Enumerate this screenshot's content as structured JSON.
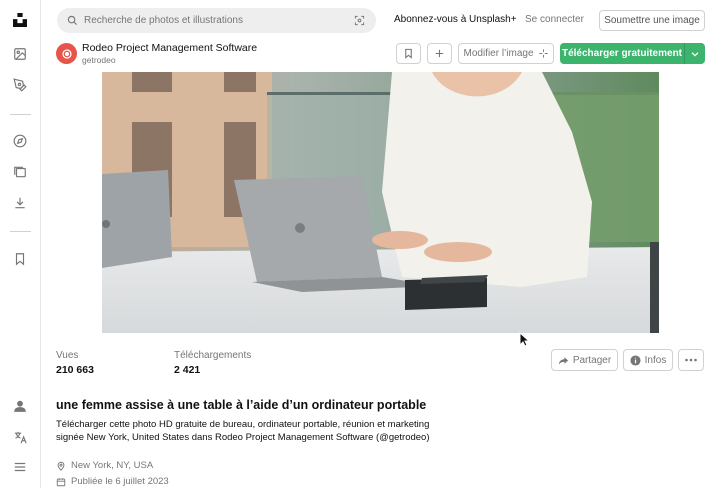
{
  "search": {
    "placeholder": "Recherche de photos et illustrations"
  },
  "header": {
    "subscribe_label": "Abonnez-vous à Unsplash+",
    "login_label": "Se connecter",
    "submit_label": "Soumettre une image"
  },
  "author": {
    "name": "Rodeo Project Management Software",
    "handle": "getrodeo"
  },
  "actions": {
    "edit_label": "Modifier l’image",
    "download_label": "Télécharger gratuitement"
  },
  "stats": {
    "views_label": "Vues",
    "views_value": "210 663",
    "downloads_label": "Téléchargements",
    "downloads_value": "2 421"
  },
  "meta_actions": {
    "share_label": "Partager",
    "info_label": "Infos"
  },
  "details": {
    "title": "une femme assise à une table à l’aide d’un ordinateur portable",
    "description_line1": "Télécharger cette photo HD gratuite de bureau, ordinateur portable, réunion et marketing",
    "description_line2": "signée New York, United States dans Rodeo Project Management Software (@getrodeo)",
    "location": "New York, NY, USA",
    "published": "Publiée le 6 juillet 2023"
  },
  "colors": {
    "accent_green": "#3cb46e",
    "brand_red": "#e8544a"
  }
}
